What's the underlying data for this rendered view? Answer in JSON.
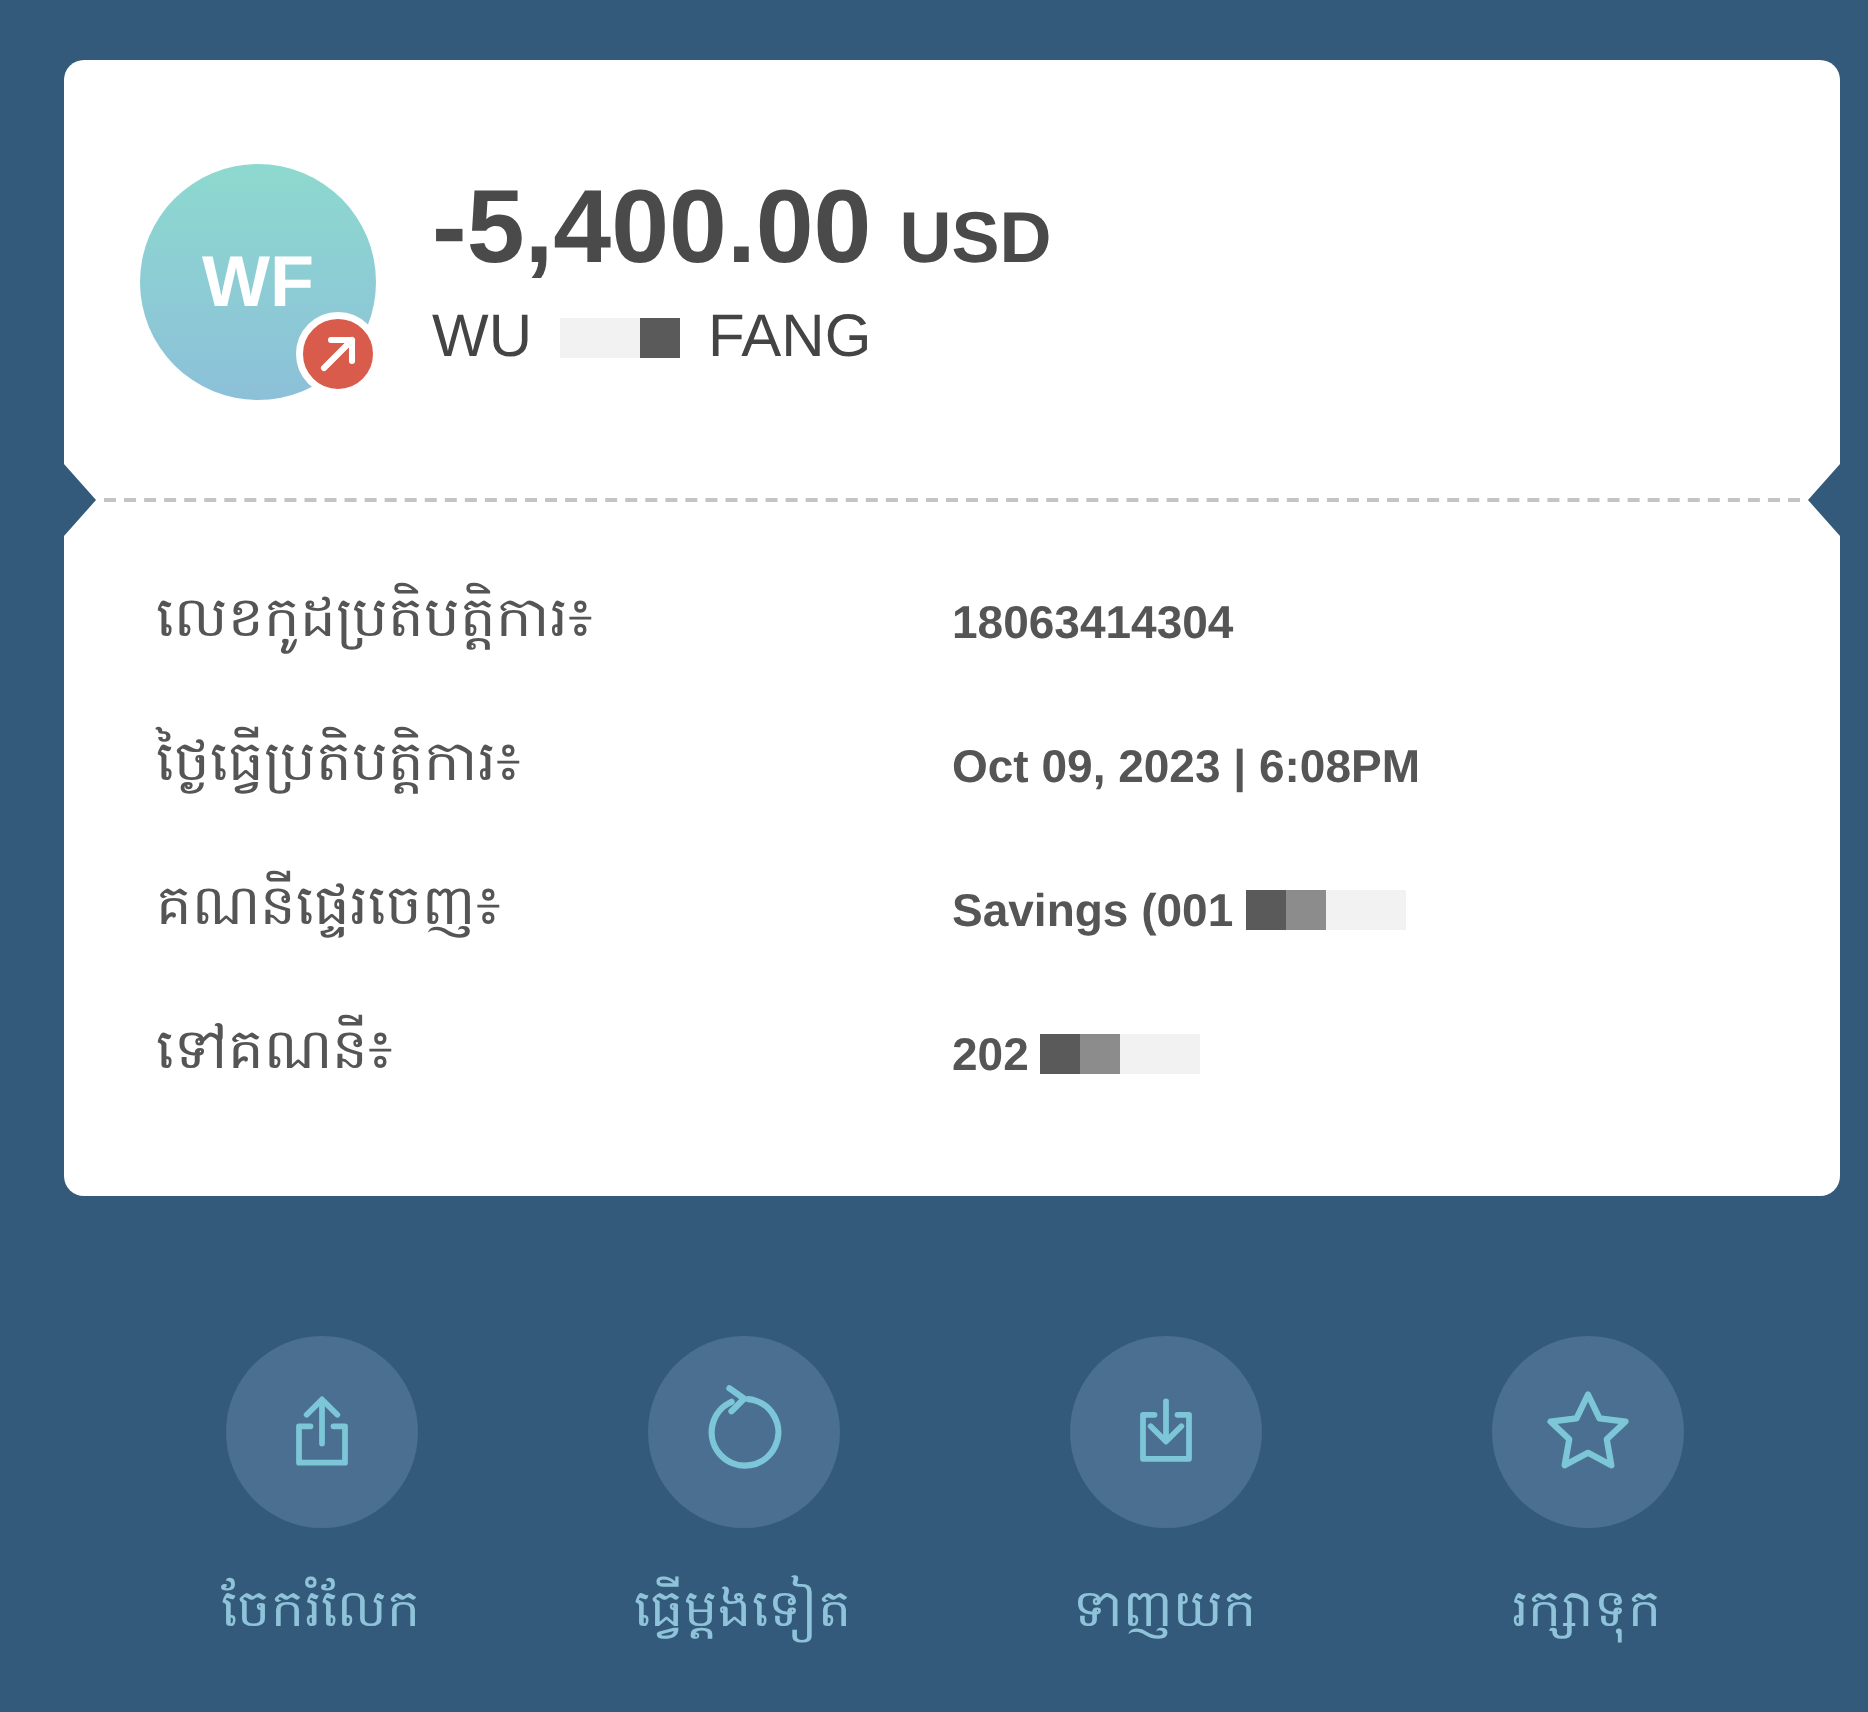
{
  "transaction": {
    "avatar_initials": "WF",
    "amount": "-5,400.00",
    "currency": "USD",
    "name_parts": [
      {
        "text": "WU",
        "redacted_after": true
      },
      {
        "text": "FANG",
        "redacted_after": false
      }
    ]
  },
  "details": [
    {
      "label": "លេខកូដប្រតិបត្តិការ៖",
      "value": "18063414304",
      "redacted": false
    },
    {
      "label": "ថ្ងៃធ្វើប្រតិបត្តិការ៖",
      "value": "Oct 09, 2023 | 6:08PM",
      "redacted": false
    },
    {
      "label": "គណនីផ្ទេរចេញ៖",
      "value": "Savings (001",
      "redacted": true
    },
    {
      "label": "ទៅគណនី៖",
      "value": "202",
      "redacted": true
    }
  ],
  "actions": [
    {
      "kind": "share",
      "label": "ចែករំលែក"
    },
    {
      "kind": "repeat",
      "label": "ធ្វើម្តងទៀត"
    },
    {
      "kind": "download",
      "label": "ទាញយក"
    },
    {
      "kind": "favorite",
      "label": "រក្សាទុក"
    }
  ]
}
